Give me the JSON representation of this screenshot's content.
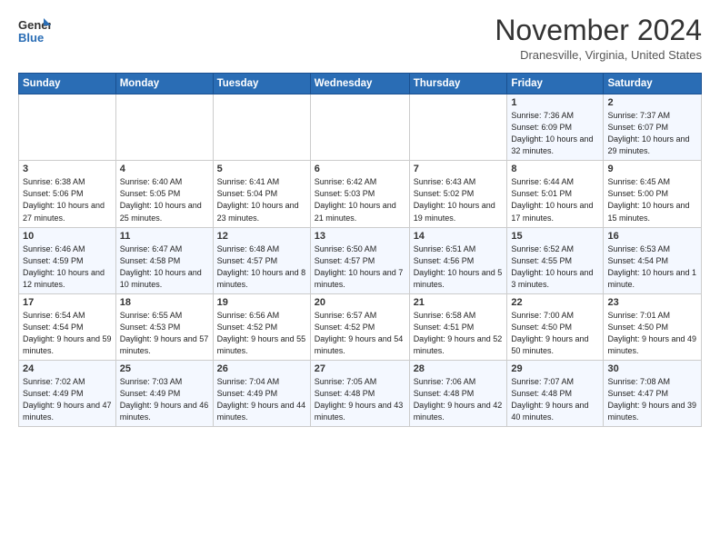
{
  "logo": {
    "general": "General",
    "blue": "Blue"
  },
  "header": {
    "month": "November 2024",
    "location": "Dranesville, Virginia, United States"
  },
  "weekdays": [
    "Sunday",
    "Monday",
    "Tuesday",
    "Wednesday",
    "Thursday",
    "Friday",
    "Saturday"
  ],
  "weeks": [
    [
      {
        "day": "",
        "info": ""
      },
      {
        "day": "",
        "info": ""
      },
      {
        "day": "",
        "info": ""
      },
      {
        "day": "",
        "info": ""
      },
      {
        "day": "",
        "info": ""
      },
      {
        "day": "1",
        "info": "Sunrise: 7:36 AM\nSunset: 6:09 PM\nDaylight: 10 hours\nand 32 minutes."
      },
      {
        "day": "2",
        "info": "Sunrise: 7:37 AM\nSunset: 6:07 PM\nDaylight: 10 hours\nand 29 minutes."
      }
    ],
    [
      {
        "day": "3",
        "info": "Sunrise: 6:38 AM\nSunset: 5:06 PM\nDaylight: 10 hours\nand 27 minutes."
      },
      {
        "day": "4",
        "info": "Sunrise: 6:40 AM\nSunset: 5:05 PM\nDaylight: 10 hours\nand 25 minutes."
      },
      {
        "day": "5",
        "info": "Sunrise: 6:41 AM\nSunset: 5:04 PM\nDaylight: 10 hours\nand 23 minutes."
      },
      {
        "day": "6",
        "info": "Sunrise: 6:42 AM\nSunset: 5:03 PM\nDaylight: 10 hours\nand 21 minutes."
      },
      {
        "day": "7",
        "info": "Sunrise: 6:43 AM\nSunset: 5:02 PM\nDaylight: 10 hours\nand 19 minutes."
      },
      {
        "day": "8",
        "info": "Sunrise: 6:44 AM\nSunset: 5:01 PM\nDaylight: 10 hours\nand 17 minutes."
      },
      {
        "day": "9",
        "info": "Sunrise: 6:45 AM\nSunset: 5:00 PM\nDaylight: 10 hours\nand 15 minutes."
      }
    ],
    [
      {
        "day": "10",
        "info": "Sunrise: 6:46 AM\nSunset: 4:59 PM\nDaylight: 10 hours\nand 12 minutes."
      },
      {
        "day": "11",
        "info": "Sunrise: 6:47 AM\nSunset: 4:58 PM\nDaylight: 10 hours\nand 10 minutes."
      },
      {
        "day": "12",
        "info": "Sunrise: 6:48 AM\nSunset: 4:57 PM\nDaylight: 10 hours\nand 8 minutes."
      },
      {
        "day": "13",
        "info": "Sunrise: 6:50 AM\nSunset: 4:57 PM\nDaylight: 10 hours\nand 7 minutes."
      },
      {
        "day": "14",
        "info": "Sunrise: 6:51 AM\nSunset: 4:56 PM\nDaylight: 10 hours\nand 5 minutes."
      },
      {
        "day": "15",
        "info": "Sunrise: 6:52 AM\nSunset: 4:55 PM\nDaylight: 10 hours\nand 3 minutes."
      },
      {
        "day": "16",
        "info": "Sunrise: 6:53 AM\nSunset: 4:54 PM\nDaylight: 10 hours\nand 1 minute."
      }
    ],
    [
      {
        "day": "17",
        "info": "Sunrise: 6:54 AM\nSunset: 4:54 PM\nDaylight: 9 hours\nand 59 minutes."
      },
      {
        "day": "18",
        "info": "Sunrise: 6:55 AM\nSunset: 4:53 PM\nDaylight: 9 hours\nand 57 minutes."
      },
      {
        "day": "19",
        "info": "Sunrise: 6:56 AM\nSunset: 4:52 PM\nDaylight: 9 hours\nand 55 minutes."
      },
      {
        "day": "20",
        "info": "Sunrise: 6:57 AM\nSunset: 4:52 PM\nDaylight: 9 hours\nand 54 minutes."
      },
      {
        "day": "21",
        "info": "Sunrise: 6:58 AM\nSunset: 4:51 PM\nDaylight: 9 hours\nand 52 minutes."
      },
      {
        "day": "22",
        "info": "Sunrise: 7:00 AM\nSunset: 4:50 PM\nDaylight: 9 hours\nand 50 minutes."
      },
      {
        "day": "23",
        "info": "Sunrise: 7:01 AM\nSunset: 4:50 PM\nDaylight: 9 hours\nand 49 minutes."
      }
    ],
    [
      {
        "day": "24",
        "info": "Sunrise: 7:02 AM\nSunset: 4:49 PM\nDaylight: 9 hours\nand 47 minutes."
      },
      {
        "day": "25",
        "info": "Sunrise: 7:03 AM\nSunset: 4:49 PM\nDaylight: 9 hours\nand 46 minutes."
      },
      {
        "day": "26",
        "info": "Sunrise: 7:04 AM\nSunset: 4:49 PM\nDaylight: 9 hours\nand 44 minutes."
      },
      {
        "day": "27",
        "info": "Sunrise: 7:05 AM\nSunset: 4:48 PM\nDaylight: 9 hours\nand 43 minutes."
      },
      {
        "day": "28",
        "info": "Sunrise: 7:06 AM\nSunset: 4:48 PM\nDaylight: 9 hours\nand 42 minutes."
      },
      {
        "day": "29",
        "info": "Sunrise: 7:07 AM\nSunset: 4:48 PM\nDaylight: 9 hours\nand 40 minutes."
      },
      {
        "day": "30",
        "info": "Sunrise: 7:08 AM\nSunset: 4:47 PM\nDaylight: 9 hours\nand 39 minutes."
      }
    ]
  ]
}
